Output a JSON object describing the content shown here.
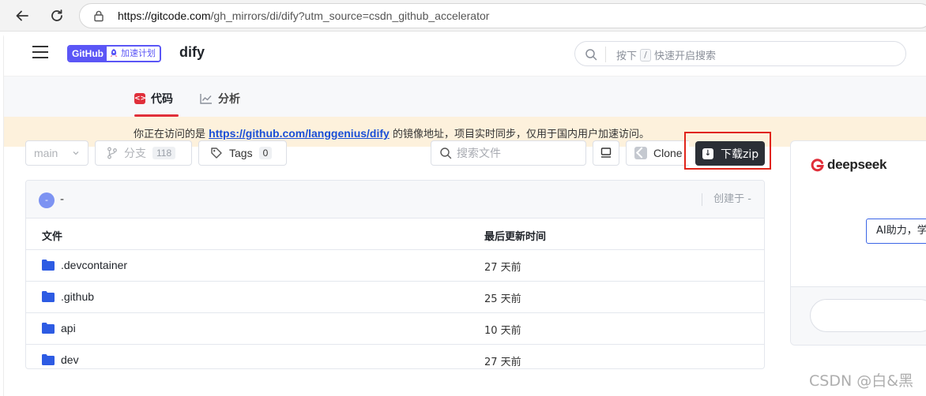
{
  "browser": {
    "url_host": "https://gitcode.com",
    "url_path": "/gh_mirrors/di/dify?utm_source=csdn_github_accelerator"
  },
  "header": {
    "badge_left": "GitHub",
    "badge_right": "加速计划",
    "repo_name": "dify",
    "search_prefix": "按下",
    "search_key": "/",
    "search_suffix": "快速开启搜索"
  },
  "tabs": [
    {
      "label": "代码",
      "active": true
    },
    {
      "label": "分析",
      "active": false
    }
  ],
  "notice": {
    "prefix": "你正在访问的是",
    "link": "https://github.com/langgenius/dify",
    "suffix": "的镜像地址，项目实时同步，仅用于国内用户加速访问。"
  },
  "toolbar": {
    "branch": "main",
    "branches_label": "分支",
    "branches_count": "118",
    "tags_label": "Tags",
    "tags_count": "0",
    "file_search_placeholder": "搜索文件",
    "clone_label": "Clone",
    "download_label": "下载zip"
  },
  "commit": {
    "avatar_text": "-",
    "message": "-",
    "created": "创建于 -"
  },
  "table": {
    "col_file": "文件",
    "col_updated": "最后更新时间",
    "rows": [
      {
        "name": ".devcontainer",
        "updated": "27 天前"
      },
      {
        "name": ".github",
        "updated": "25 天前"
      },
      {
        "name": "api",
        "updated": "10 天前"
      },
      {
        "name": "dev",
        "updated": "27 天前"
      }
    ]
  },
  "side_card": {
    "brand": "deepseek",
    "ai_button": "AI助力，学"
  },
  "watermark": "CSDN @白&黑",
  "colors": {
    "accent_red": "#e02f3a",
    "brand_purple": "#5b56f6",
    "link_blue": "#1a4fd6",
    "notice_bg": "#fdf1dc",
    "download_bg": "#2b2f36",
    "folder_blue": "#2d5be3"
  }
}
